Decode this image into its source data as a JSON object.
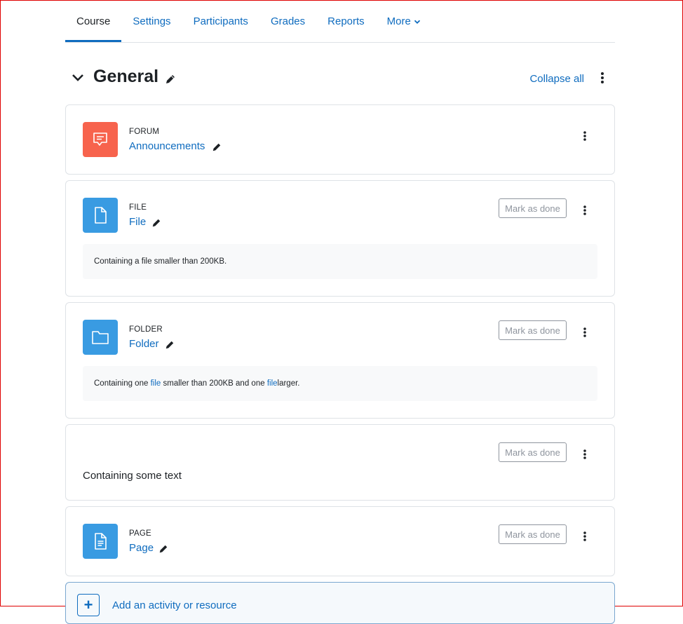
{
  "tabs": [
    {
      "label": "Course",
      "active": true
    },
    {
      "label": "Settings"
    },
    {
      "label": "Participants"
    },
    {
      "label": "Grades"
    },
    {
      "label": "Reports"
    },
    {
      "label": "More"
    }
  ],
  "section": {
    "title": "General",
    "collapse_all": "Collapse all"
  },
  "activities": [
    {
      "type": "FORUM",
      "name": "Announcements",
      "icon": "forum-icon",
      "icon_color": "#f7634d"
    },
    {
      "type": "FILE",
      "name": "File",
      "icon": "file-icon",
      "icon_color": "#399be2",
      "done_label": "Mark as done",
      "description": "Containing a file smaller than 200KB."
    },
    {
      "type": "FOLDER",
      "name": "Folder",
      "icon": "folder-icon",
      "icon_color": "#399be2",
      "done_label": "Mark as done",
      "description_parts": [
        "Containing one ",
        "file",
        " smaller than 200KB and one ",
        "file",
        " larger."
      ]
    },
    {
      "done_label": "Mark as done",
      "text": "Containing some text"
    },
    {
      "type": "PAGE",
      "name": "Page",
      "icon": "page-icon",
      "icon_color": "#399be2",
      "done_label": "Mark as done"
    }
  ],
  "add_activity": {
    "label": "Add an activity or resource"
  },
  "colors": {
    "link": "#0f6cbf",
    "text": "#1d2125",
    "border": "#dee2e6"
  }
}
